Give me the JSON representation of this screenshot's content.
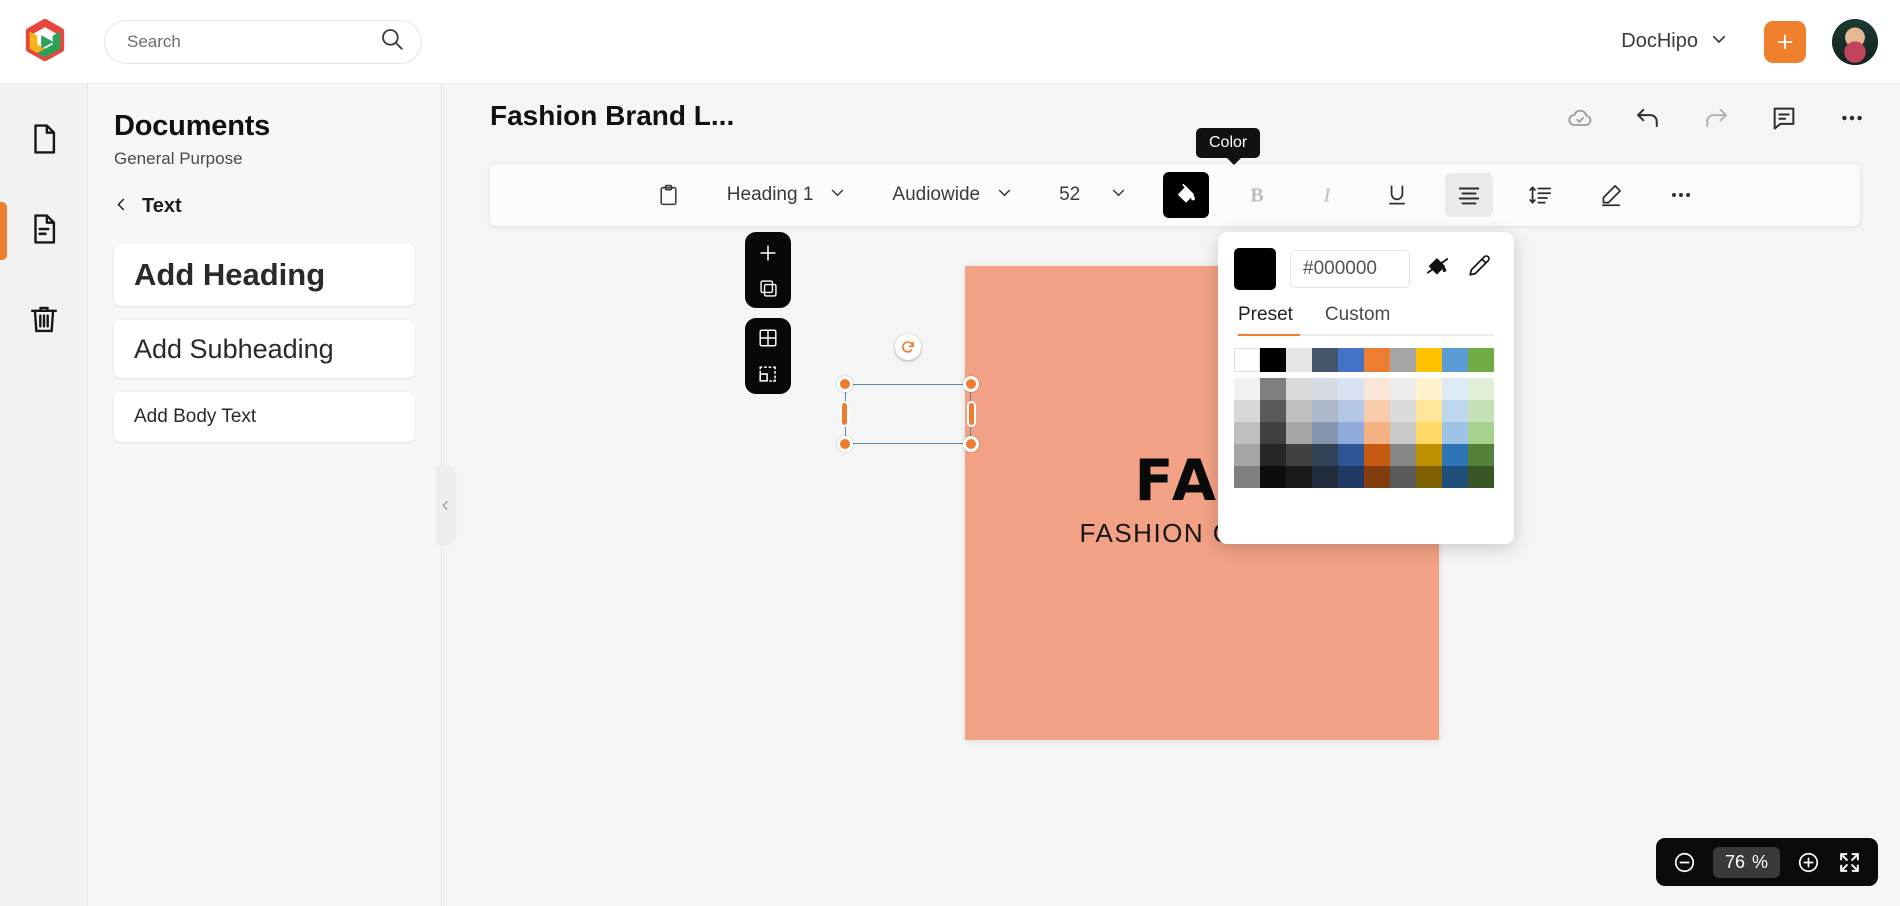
{
  "app": {
    "brand_logo": "dochipo-logo",
    "accent_color": "#F07F2D",
    "canvas_color": "#F2A184"
  },
  "topbar": {
    "search": {
      "placeholder": "Search",
      "value": "",
      "icon": "search-icon"
    },
    "account_label": "DocHipo",
    "account_chevron": "chevron-down-icon",
    "create_label": "+",
    "avatar_label": "user-avatar"
  },
  "rail": {
    "items": [
      {
        "name": "page-icon",
        "label": "Pages",
        "active": false
      },
      {
        "name": "document-text-icon",
        "label": "Document",
        "active": true
      },
      {
        "name": "trash-icon",
        "label": "Trash",
        "active": false
      }
    ]
  },
  "panel": {
    "title": "Documents",
    "subtitle": "General Purpose",
    "back_label": "Text",
    "back_icon": "chevron-left-icon",
    "cards": [
      {
        "label": "Add Heading"
      },
      {
        "label": "Add Subheading"
      },
      {
        "label": "Add Body Text"
      }
    ],
    "collapse_icon": "chevron-left-icon"
  },
  "editor": {
    "doc_title": "Fashion Brand L...",
    "actions": [
      {
        "name": "cloud-saved-icon",
        "label": "Saved"
      },
      {
        "name": "undo-icon",
        "label": "Undo"
      },
      {
        "name": "redo-icon",
        "label": "Redo"
      },
      {
        "name": "comment-icon",
        "label": "Comments"
      },
      {
        "name": "more-horizontal-icon",
        "label": "More"
      }
    ]
  },
  "toolbar": {
    "clipboard_label": "Copy style",
    "style_value": "Heading 1",
    "font_value": "Audiowide",
    "size_value": "52",
    "buttons": [
      {
        "name": "fill-color-button",
        "label": "Color",
        "active": true
      },
      {
        "name": "bold-button",
        "label": "B",
        "disabled": true
      },
      {
        "name": "italic-button",
        "label": "I",
        "disabled": true
      },
      {
        "name": "underline-button",
        "label": "U",
        "disabled": false
      },
      {
        "name": "align-center-button",
        "label": "Align center",
        "active": true
      },
      {
        "name": "line-height-button",
        "label": "Line height"
      },
      {
        "name": "highlighter-button",
        "label": "Highlight"
      },
      {
        "name": "more-options-button",
        "label": "More"
      }
    ],
    "tooltip": "Color"
  },
  "color_popover": {
    "hex_value": "#000000",
    "hex_placeholder": "#000000",
    "current_swatch": "#000000",
    "no_fill_icon": "paint-bucket-slash-icon",
    "eyedropper_icon": "eyedropper-icon",
    "tabs": [
      {
        "label": "Preset",
        "active": true
      },
      {
        "label": "Custom",
        "active": false
      }
    ],
    "base_colors": [
      "#FFFFFF",
      "#000000",
      "#E6E6E6",
      "#44546A",
      "#4472C4",
      "#ED7D31",
      "#A5A5A5",
      "#FFC000",
      "#5B9BD5",
      "#70AD47"
    ],
    "tint_rows": [
      [
        "#F1F1F1",
        "#7F7F7F",
        "#D9D9D9",
        "#D6DCE5",
        "#D9E2F3",
        "#FBE5D6",
        "#EDEDED",
        "#FFF2CC",
        "#DEEBF7",
        "#E2EFD9"
      ],
      [
        "#D8D8D8",
        "#595959",
        "#BFBFBF",
        "#ADB9CA",
        "#B4C7E7",
        "#F8CBAD",
        "#DBDBDB",
        "#FFE699",
        "#BDD7EE",
        "#C5E0B4"
      ],
      [
        "#BFBFBF",
        "#3F3F3F",
        "#A6A6A6",
        "#8496B0",
        "#8FAADC",
        "#F4B183",
        "#C9C9C9",
        "#FFD966",
        "#9DC3E6",
        "#A9D18E"
      ],
      [
        "#A6A6A6",
        "#262626",
        "#404040",
        "#334257",
        "#2F5597",
        "#C55A11",
        "#878787",
        "#BF9000",
        "#2E75B6",
        "#538135"
      ],
      [
        "#7F7F7F",
        "#0D0D0D",
        "#1A1A1A",
        "#222C3C",
        "#1F3864",
        "#833C0C",
        "#5A5A5A",
        "#7F6000",
        "#1F4E79",
        "#375623"
      ]
    ]
  },
  "canvas": {
    "artboard": {
      "bg": "#F2A184",
      "logo_text": "FAB",
      "tagline": "FASHION OUTLET"
    },
    "float_tools": [
      {
        "name": "add-element-icon",
        "label": "Add"
      },
      {
        "name": "duplicate-icon",
        "label": "Duplicate"
      },
      {
        "name": "grid-icon",
        "label": "Grid"
      },
      {
        "name": "crop-select-icon",
        "label": "Select area"
      }
    ],
    "selection": {
      "rotate_icon": "rotate-handle-icon",
      "handles": 6
    }
  },
  "zoombar": {
    "zoom_out_icon": "zoom-out-icon",
    "zoom_in_icon": "zoom-in-icon",
    "fullscreen_icon": "fullscreen-icon",
    "value": "76",
    "unit": "%"
  }
}
